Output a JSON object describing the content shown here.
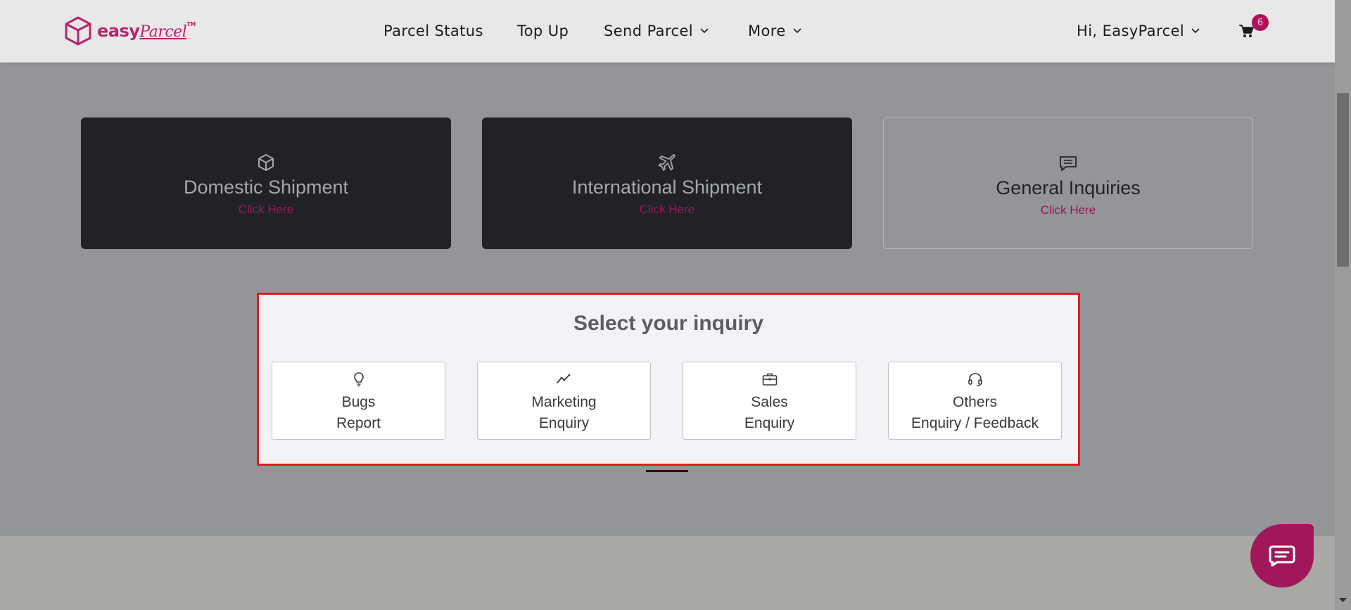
{
  "logo": {
    "text_main": "easy",
    "text_script": "Parcel",
    "tm": "TM"
  },
  "nav": {
    "items": [
      {
        "label": "Parcel Status"
      },
      {
        "label": "Top Up"
      },
      {
        "label": "Send Parcel"
      },
      {
        "label": "More"
      }
    ],
    "greeting": "Hi, EasyParcel",
    "cart_count": "6"
  },
  "cards": [
    {
      "title": "Domestic Shipment",
      "link": "Click Here",
      "icon": "box-icon"
    },
    {
      "title": "International Shipment",
      "link": "Click Here",
      "icon": "plane-icon"
    },
    {
      "title": "General Inquiries",
      "link": "Click Here",
      "icon": "chat-bubble-icon"
    }
  ],
  "modal": {
    "title": "Select your inquiry",
    "options": [
      {
        "line1": "Bugs",
        "line2": "Report",
        "icon": "lightbulb-icon"
      },
      {
        "line1": "Marketing",
        "line2": "Enquiry",
        "icon": "trend-icon"
      },
      {
        "line1": "Sales",
        "line2": "Enquiry",
        "icon": "briefcase-icon"
      },
      {
        "line1": "Others",
        "line2": "Enquiry / Feedback",
        "icon": "headset-icon"
      }
    ]
  },
  "colors": {
    "overlay": "#939598",
    "brand": "#b5266a",
    "highlight_border": "#e01d1d",
    "dark_card": "#202227"
  }
}
